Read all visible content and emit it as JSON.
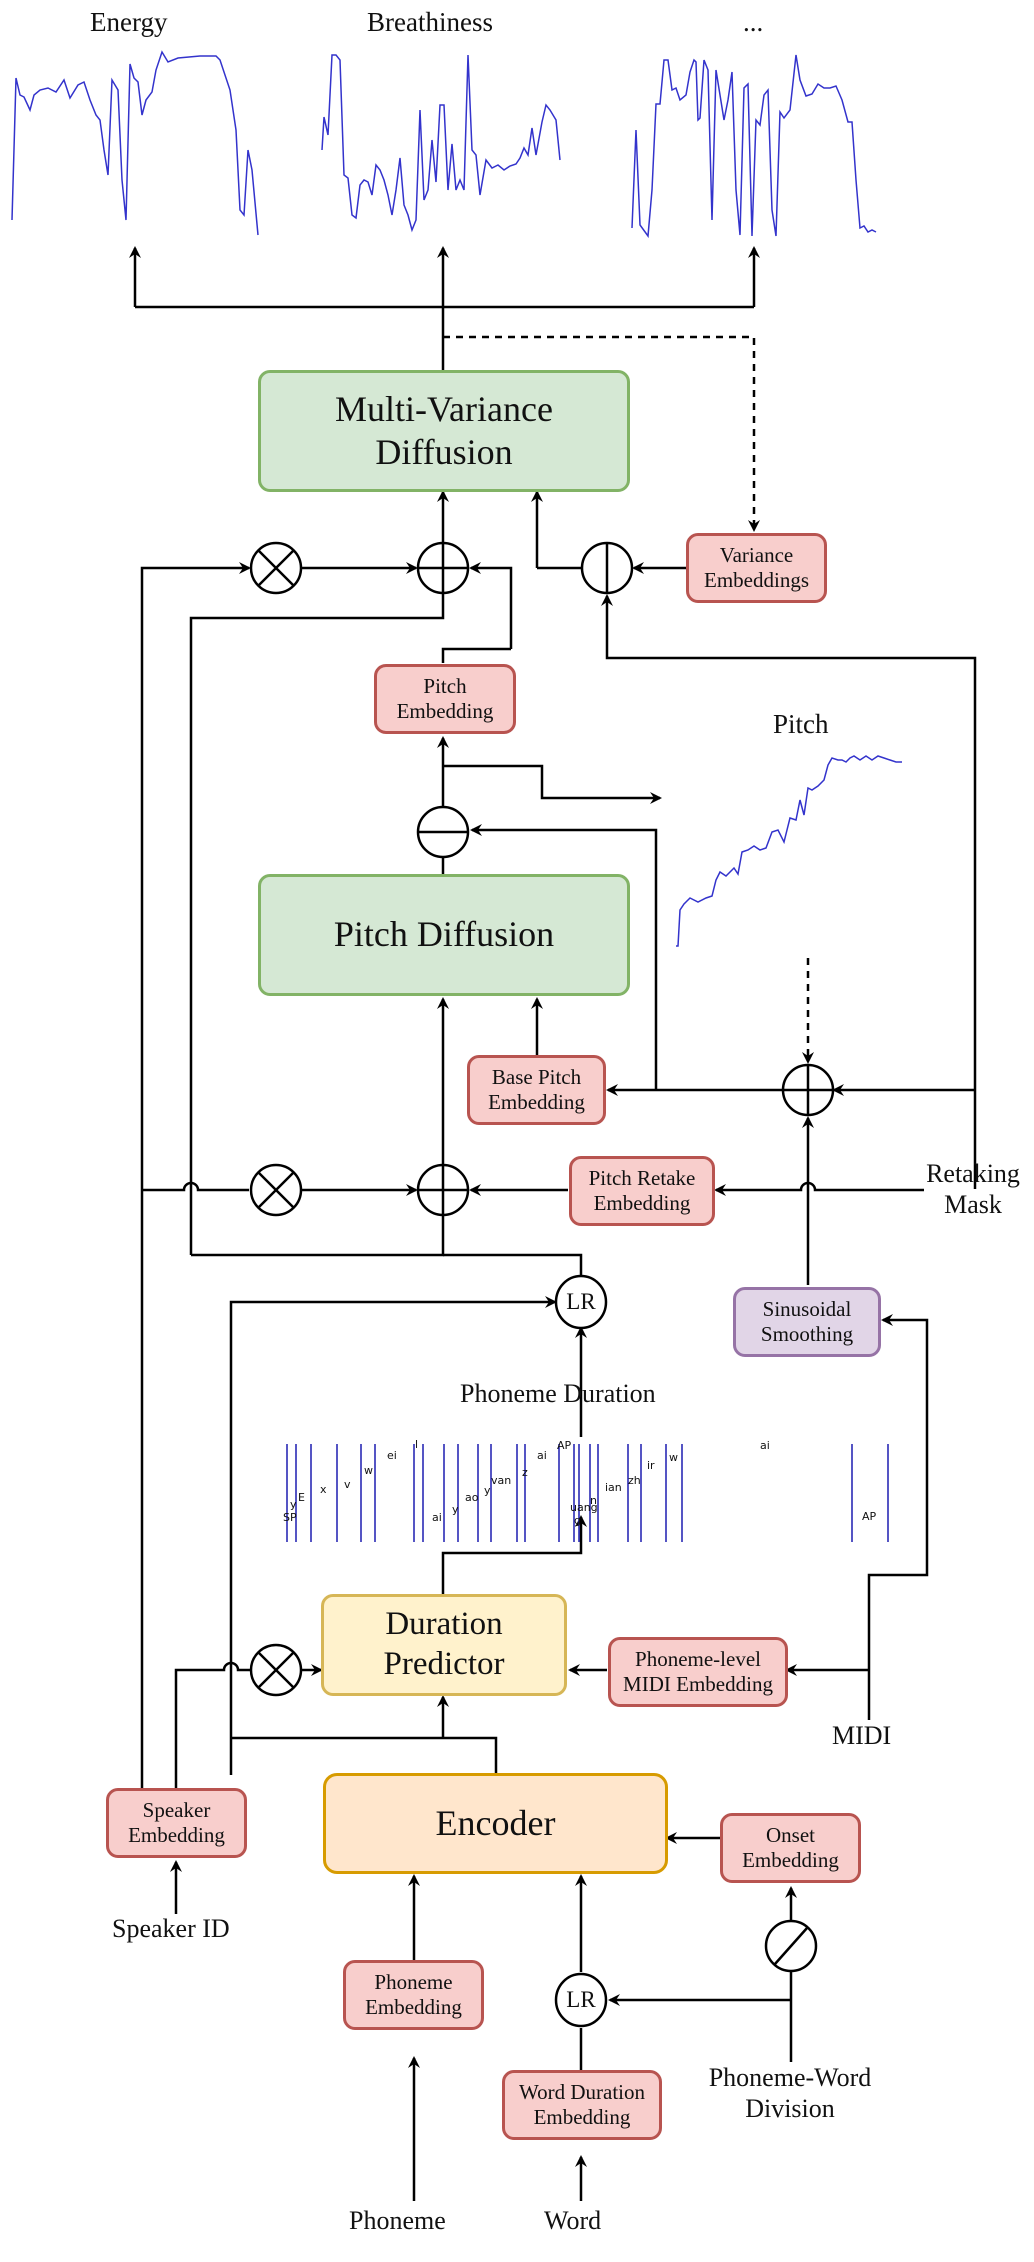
{
  "plots": {
    "energy": {
      "title": "Energy"
    },
    "breathiness": {
      "title": "Breathiness"
    },
    "more": {
      "title": "..."
    },
    "pitch": {
      "title": "Pitch"
    },
    "line_color": "#3333cc"
  },
  "blocks": {
    "multi_variance_diffusion": "Multi-Variance Diffusion",
    "pitch_diffusion": "Pitch Diffusion",
    "duration_predictor": "Duration Predictor",
    "encoder": "Encoder"
  },
  "embeddings": {
    "variance": "Variance Embeddings",
    "pitch": "Pitch Embedding",
    "base_pitch": "Base Pitch Embedding",
    "pitch_retake": "Pitch Retake Embedding",
    "phoneme_midi": "Phoneme-level MIDI Embedding",
    "speaker": "Speaker Embedding",
    "onset": "Onset Embedding",
    "phoneme": "Phoneme Embedding",
    "word_duration": "Word Duration Embedding"
  },
  "modules": {
    "sinusoidal_smoothing": "Sinusoidal Smoothing",
    "length_regulator": "LR"
  },
  "inputs": {
    "retaking_mask": "Retaking Mask",
    "midi": "MIDI",
    "speaker_id": "Speaker ID",
    "phoneme_word_division": "Phoneme-Word Division",
    "phoneme": "Phoneme",
    "word": "Word"
  },
  "phoneme_duration": {
    "title": "Phoneme Duration",
    "labels": [
      "SP",
      "y",
      "E",
      "x",
      "v",
      "w",
      "ei",
      "l",
      "ai",
      "y",
      "ao",
      "y",
      "van",
      "z",
      "ai",
      "AP",
      "g",
      "uang",
      "n",
      "ian",
      "zh",
      "ir",
      "w",
      "ai",
      "AP"
    ]
  },
  "colors": {
    "diffusion": "#d5e8d4",
    "predictor": "#fff2cc",
    "encoder": "#ffe6cc",
    "embedding": "#f8cecc",
    "smoothing": "#e1d5e7"
  }
}
